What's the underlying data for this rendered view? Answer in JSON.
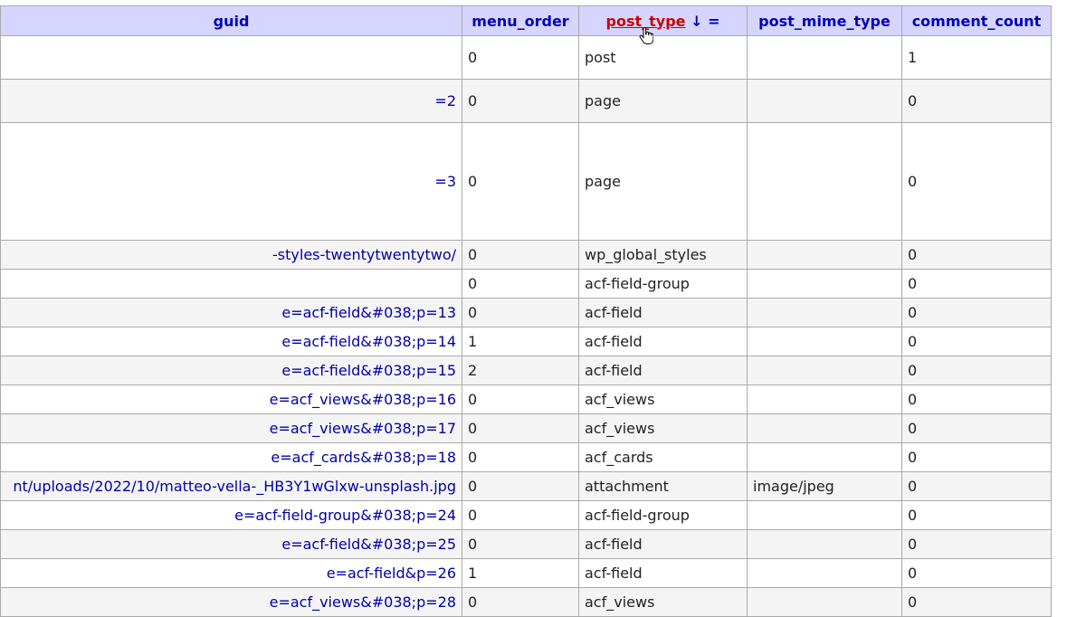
{
  "columns": {
    "guid": "guid",
    "menu_order": "menu_order",
    "post_type": "post_type",
    "post_type_sort": "↓ =",
    "post_mime_type": "post_mime_type",
    "comment_count": "comment_count"
  },
  "rows": [
    {
      "guid": "",
      "menu_order": "0",
      "post_type": "post",
      "post_mime_type": "",
      "comment_count": "1"
    },
    {
      "guid": "=2",
      "menu_order": "0",
      "post_type": "page",
      "post_mime_type": "",
      "comment_count": "0"
    },
    {
      "guid": "=3",
      "menu_order": "0",
      "post_type": "page",
      "post_mime_type": "",
      "comment_count": "0"
    },
    {
      "guid": "-styles-twentytwentytwo/",
      "menu_order": "0",
      "post_type": "wp_global_styles",
      "post_mime_type": "",
      "comment_count": "0"
    },
    {
      "guid": "",
      "menu_order": "0",
      "post_type": "acf-field-group",
      "post_mime_type": "",
      "comment_count": "0"
    },
    {
      "guid": "e=acf-field&#038;p=13",
      "menu_order": "0",
      "post_type": "acf-field",
      "post_mime_type": "",
      "comment_count": "0"
    },
    {
      "guid": "e=acf-field&#038;p=14",
      "menu_order": "1",
      "post_type": "acf-field",
      "post_mime_type": "",
      "comment_count": "0"
    },
    {
      "guid": "e=acf-field&#038;p=15",
      "menu_order": "2",
      "post_type": "acf-field",
      "post_mime_type": "",
      "comment_count": "0"
    },
    {
      "guid": "e=acf_views&#038;p=16",
      "menu_order": "0",
      "post_type": "acf_views",
      "post_mime_type": "",
      "comment_count": "0"
    },
    {
      "guid": "e=acf_views&#038;p=17",
      "menu_order": "0",
      "post_type": "acf_views",
      "post_mime_type": "",
      "comment_count": "0"
    },
    {
      "guid": "e=acf_cards&#038;p=18",
      "menu_order": "0",
      "post_type": "acf_cards",
      "post_mime_type": "",
      "comment_count": "0"
    },
    {
      "guid": "nt/uploads/2022/10/matteo-vella-_HB3Y1wGlxw-unsplash.jpg",
      "menu_order": "0",
      "post_type": "attachment",
      "post_mime_type": "image/jpeg",
      "comment_count": "0"
    },
    {
      "guid": "e=acf-field-group&#038;p=24",
      "menu_order": "0",
      "post_type": "acf-field-group",
      "post_mime_type": "",
      "comment_count": "0"
    },
    {
      "guid": "e=acf-field&#038;p=25",
      "menu_order": "0",
      "post_type": "acf-field",
      "post_mime_type": "",
      "comment_count": "0"
    },
    {
      "guid": "e=acf-field&p=26",
      "menu_order": "1",
      "post_type": "acf-field",
      "post_mime_type": "",
      "comment_count": "0"
    },
    {
      "guid": "e=acf_views&#038;p=28",
      "menu_order": "0",
      "post_type": "acf_views",
      "post_mime_type": "",
      "comment_count": "0"
    }
  ],
  "icons": {
    "cursor": "hand-pointer-icon"
  }
}
